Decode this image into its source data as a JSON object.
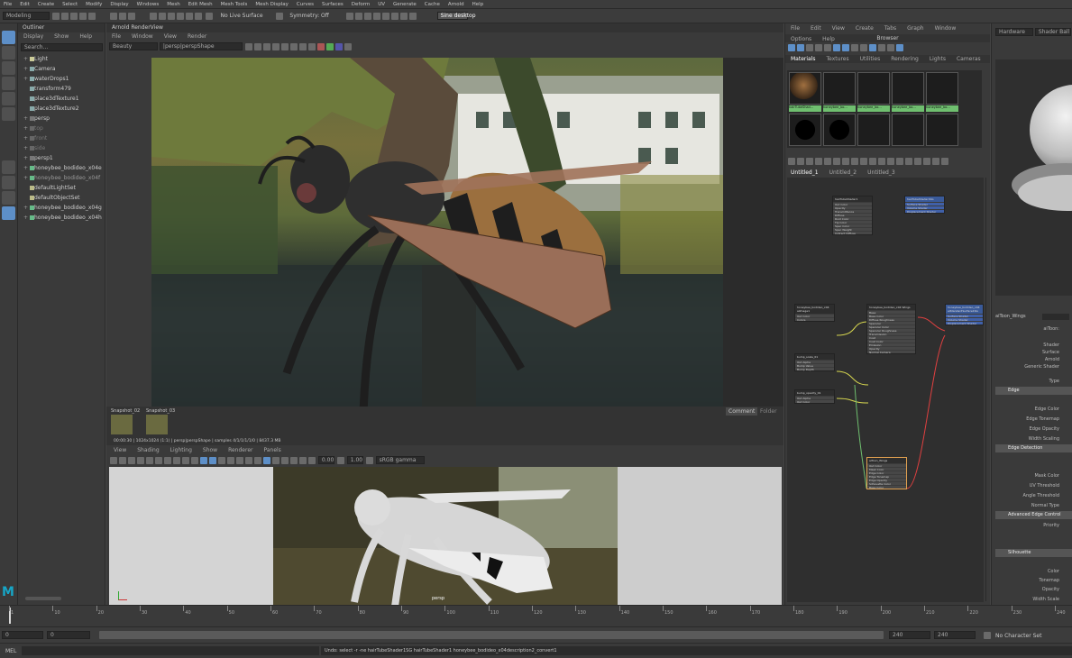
{
  "app": {
    "main_menu": [
      "File",
      "Edit",
      "Create",
      "Select",
      "Modify",
      "Display",
      "Windows",
      "Mesh",
      "Edit Mesh",
      "Mesh Tools",
      "Mesh Display",
      "Curves",
      "Surfaces",
      "Deform",
      "UV",
      "Generate",
      "Cache",
      "Arnold",
      "Help"
    ],
    "mode": "Modeling",
    "live_surface": "No Live Surface",
    "symmetry": "Symmetry: Off",
    "workspace": "Sine desktop"
  },
  "outliner": {
    "title": "Outliner",
    "menu": [
      "Display",
      "Show",
      "Help"
    ],
    "search_placeholder": "Search...",
    "items": [
      "Light",
      "Camera",
      "waterDrops1",
      "transform479",
      "place3dTexture1",
      "place3dTexture2",
      "persp",
      "top",
      "front",
      "side",
      "persp1",
      "honeybee_bodideo_x04e",
      "honeybee_bodideo_x04f",
      "defaultLightSet",
      "defaultObjectSet",
      "honeybee_bodideo_x04g",
      "honeybee_bodideo_x04h"
    ]
  },
  "render_view": {
    "title": "Arnold RenderView",
    "menu": [
      "File",
      "Window",
      "View",
      "Render"
    ],
    "mode": "Beauty",
    "camera": "|persp|perspShape",
    "snapshots": [
      "Snapshot_02",
      "Snapshot_03"
    ],
    "side_tabs": [
      "Comment",
      "Folder"
    ],
    "status": "00:00:30 | 1024x1024 (1:1) | persp|perspShape | samples 4/1/1/1/1/0 | 8437.3 MB"
  },
  "viewport": {
    "menu": [
      "View",
      "Shading",
      "Lighting",
      "Show",
      "Renderer",
      "Panels"
    ],
    "exposure": "0.00",
    "gamma": "1.00",
    "color_space": "sRGB gamma",
    "camera_label": "persp"
  },
  "hypershade": {
    "menu": [
      "File",
      "Edit",
      "View",
      "Create",
      "Tabs",
      "Graph",
      "Window",
      "Options",
      "Help"
    ],
    "browser_title": "Browser",
    "browser_tabs": [
      "Materials",
      "Textures",
      "Utilities",
      "Rendering",
      "Lights",
      "Cameras"
    ],
    "swatch_labels": [
      "hairTubeShad...",
      "honeybee_bo...",
      "honeybee_bo...",
      "honeybee_bo...",
      "honeybee_bo..."
    ],
    "editor_tabs": [
      "Untitled_1",
      "Untitled_2",
      "Untitled_3"
    ],
    "nodes": {
      "n1": {
        "title": "hairTubeShader1",
        "rows": [
          "Out Color",
          "Opacity",
          "Transmittance",
          "Diffuse",
          "Root Color",
          "Tip Color",
          "Spec Color",
          "Spec Weight",
          "Indirect Diffuse"
        ]
      },
      "n2": {
        "title": "hairTubeShader1SG",
        "rows": [
          "Surface Shader",
          "Volume Shader",
          "Displacement Shader"
        ]
      },
      "n3": {
        "title": "honeybee_bodideo_x04 aiImage1",
        "rows": [
          "Out Color",
          "Colors"
        ]
      },
      "n4": {
        "title": "honeybee_bodideo_x04 Wings",
        "rows": [
          "Base",
          "Base Color",
          "Diffuse Roughness",
          "Specular",
          "Specular Color",
          "Specular Roughness",
          "Transmission",
          "Coat",
          "Coat Color",
          "Emission",
          "Opacity",
          "Normal Camera"
        ]
      },
      "n5": {
        "title": "honeybee_bodideo_x04 aiStandardSurface1SG",
        "rows": [
          "Surface Shader",
          "Volume Shader",
          "Displacement Shader"
        ]
      },
      "n6": {
        "title": "bump_scale_01",
        "rows": [
          "Out Alpha",
          "Bump Value",
          "Bump Depth"
        ]
      },
      "n7": {
        "title": "bump_opacity_01",
        "rows": [
          "Out Alpha",
          "Out Color"
        ]
      },
      "n8": {
        "title": "aiToon_Wings",
        "rows": [
          "Out Color",
          "Mask Color",
          "Edge Color",
          "Edge Tonemap",
          "Edge Opacity",
          "Silhouette Color",
          "Base Color"
        ]
      }
    }
  },
  "attribute_editor": {
    "dropdowns": [
      "Hardware",
      "Shader Ball"
    ],
    "node_name": "aiToon_Wings",
    "type_label": "aiToon:",
    "rows_top": [
      "Shader",
      "Surface",
      "Arnold",
      "Generic Shader",
      "Type"
    ],
    "sections": [
      {
        "title": "Edge",
        "rows": [
          "Edge Color",
          "Edge Tonemap",
          "Edge Opacity",
          "Width Scaling"
        ]
      },
      {
        "title": "Edge Detection",
        "rows": [
          "Mask Color",
          "UV Threshold",
          "Angle Threshold",
          "Normal Type"
        ]
      },
      {
        "title": "Advanced Edge Control",
        "rows": [
          "Priority"
        ]
      },
      {
        "title": "Silhouette",
        "rows": [
          "Color",
          "Tonemap",
          "Opacity",
          "Width Scale"
        ]
      }
    ]
  },
  "timeline": {
    "ticks": [
      "1",
      "10",
      "20",
      "30",
      "40",
      "50",
      "60",
      "70",
      "80",
      "90",
      "100",
      "110",
      "120",
      "130",
      "140",
      "150",
      "160",
      "170",
      "180",
      "190",
      "200",
      "210",
      "220",
      "230",
      "240"
    ],
    "start": "0",
    "end": "240",
    "current": "0",
    "range_end": "240",
    "character_set": "No Character Set"
  },
  "status_line": {
    "label": "MEL",
    "message": "Undo: select -r -ne hairTubeShader1SG hairTubeShader1 honeybee_bodideo_x04description2_convert1"
  }
}
